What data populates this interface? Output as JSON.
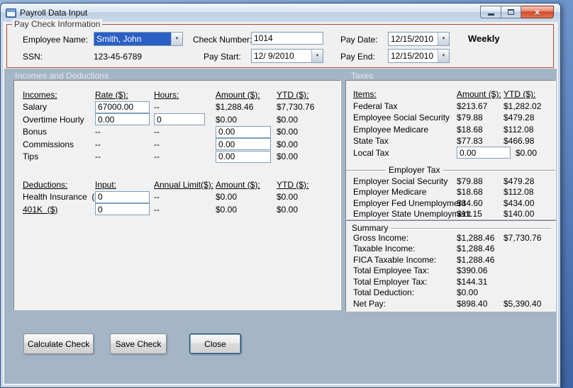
{
  "window": {
    "title": "Payroll Data Input"
  },
  "icons": {
    "dropdown_arrow": "▼",
    "close_glyph": "×"
  },
  "paycheck": {
    "group_title": "Pay Check Information",
    "fields": {
      "employee_name": {
        "label": "Employee Name:",
        "value": "Smith, John"
      },
      "ssn": {
        "label": "SSN:",
        "value": "123-45-6789"
      },
      "check_number": {
        "label": "Check Number:",
        "value": "1014"
      },
      "pay_start": {
        "label": "Pay Start:",
        "value": "12/ 9/2010"
      },
      "pay_date": {
        "label": "Pay Date:",
        "value": "12/15/2010"
      },
      "pay_end": {
        "label": "Pay End:",
        "value": "12/15/2010"
      }
    },
    "frequency": "Weekly"
  },
  "sections": {
    "incomes_header": "Incomes and Deductions",
    "taxes_header": "Taxes"
  },
  "incomes": {
    "headers": {
      "name": "Incomes:",
      "rate": "Rate ($):",
      "hours": "Hours:",
      "amount": "Amount ($):",
      "ytd": "YTD ($):"
    },
    "rows": [
      {
        "label": "Salary",
        "rate": "67000.00",
        "hours": "--",
        "amount": "$1,288.46",
        "ytd": "$7,730.76"
      },
      {
        "label": "Overtime Hourly",
        "rate": "0.00",
        "hours": "0",
        "amount": "$0.00",
        "ytd": "$0.00"
      },
      {
        "label": "Bonus",
        "rate": "--",
        "hours": "--",
        "amount": "0.00",
        "ytd": "$0.00"
      },
      {
        "label": "Commissions",
        "rate": "--",
        "hours": "--",
        "amount": "0.00",
        "ytd": "$0.00"
      },
      {
        "label": "Tips",
        "rate": "--",
        "hours": "--",
        "amount": "0.00",
        "ytd": "$0.00"
      }
    ]
  },
  "deductions": {
    "headers": {
      "name": "Deductions:",
      "input": "Input:",
      "limit": "Annual Limit($):",
      "amount": "Amount ($):",
      "ytd": "YTD ($):"
    },
    "rows": [
      {
        "label": "Health Insurance  ($)",
        "input": "0",
        "limit": "--",
        "amount": "$0.00",
        "ytd": "$0.00"
      },
      {
        "label": "401K  ($)",
        "input": "0",
        "limit": "--",
        "amount": "$0.00",
        "ytd": "$0.00"
      }
    ]
  },
  "taxes": {
    "headers": {
      "items": "Items:",
      "amount": "Amount ($):",
      "ytd": "YTD ($):"
    },
    "employee_rows": [
      {
        "label": "Federal Tax",
        "amount": "$213.67",
        "ytd": "$1,282.02"
      },
      {
        "label": "Employee Social Security",
        "amount": "$79.88",
        "ytd": "$479.28"
      },
      {
        "label": "Employee Medicare",
        "amount": "$18.68",
        "ytd": "$112.08"
      },
      {
        "label": "State Tax",
        "amount": "$77.83",
        "ytd": "$466.98"
      },
      {
        "label": "Local Tax",
        "amount": "0.00",
        "ytd": "$0.00"
      }
    ],
    "employer_header": "Employer Tax",
    "employer_rows": [
      {
        "label": "Employer Social Security",
        "amount": "$79.88",
        "ytd": "$479.28"
      },
      {
        "label": "Employer Medicare",
        "amount": "$18.68",
        "ytd": "$112.08"
      },
      {
        "label": "Employer Fed Unemployment",
        "amount": "$34.60",
        "ytd": "$434.00"
      },
      {
        "label": "Employer State Unemployment",
        "amount": "$11.15",
        "ytd": "$140.00"
      }
    ]
  },
  "summary": {
    "group_title": "Summary",
    "rows": [
      {
        "label": "Gross Income:",
        "amount": "$1,288.46",
        "ytd": "$7,730.76"
      },
      {
        "label": "Taxable Income:",
        "amount": "$1,288.46",
        "ytd": ""
      },
      {
        "label": "FICA Taxable Income:",
        "amount": "$1,288.46",
        "ytd": ""
      },
      {
        "label": "Total Employee Tax:",
        "amount": "$390.06",
        "ytd": ""
      },
      {
        "label": "Total Employer Tax:",
        "amount": "$144.31",
        "ytd": ""
      },
      {
        "label": "Total Deduction:",
        "amount": "$0.00",
        "ytd": ""
      },
      {
        "label": "Net Pay:",
        "amount": "$898.40",
        "ytd": "$5,390.40"
      }
    ]
  },
  "buttons": {
    "calculate": "Calculate Check",
    "save": "Save Check",
    "close": "Close"
  }
}
